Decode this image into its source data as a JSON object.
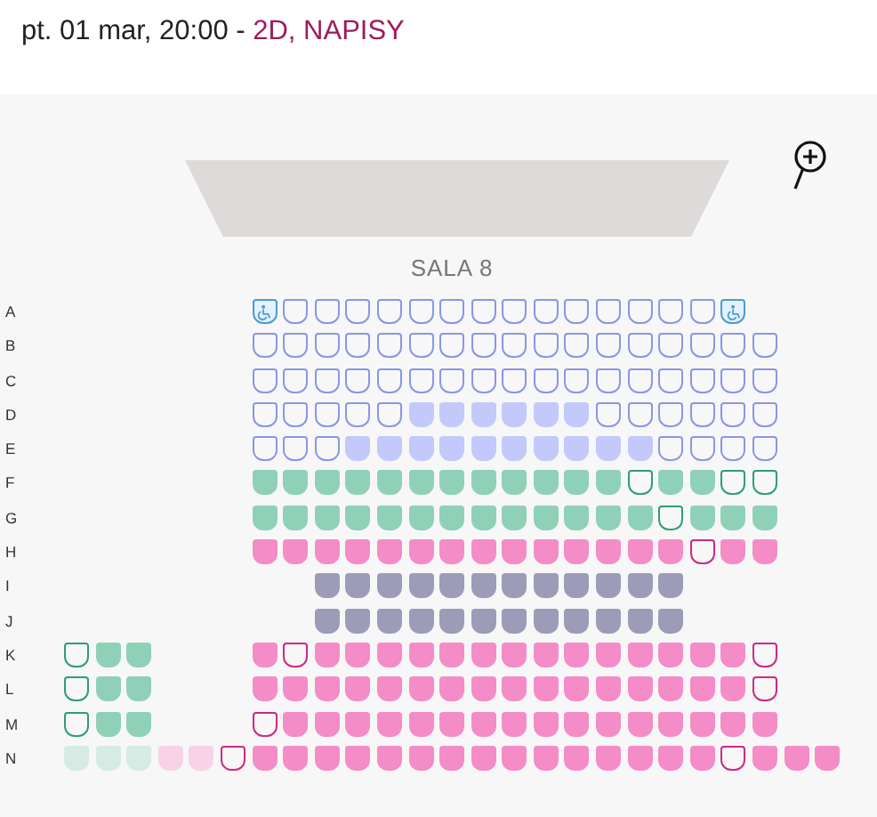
{
  "header": {
    "showtime": "pt. 01 mar, 20:00 - ",
    "format": "2D, NAPISY"
  },
  "hall": {
    "name": "SALA 8"
  },
  "rows": [
    {
      "label": "A",
      "seats": [
        {
          "kind": "aisle"
        },
        {
          "kind": "aisle"
        },
        {
          "kind": "aisle"
        },
        {
          "kind": "aisle"
        },
        {
          "kind": "aisle"
        },
        {
          "kind": "aisle"
        },
        {
          "kind": "wheelchair",
          "color": "#4d9bd0",
          "taken": false
        },
        {
          "kind": "seat",
          "color": "#8a96e6",
          "taken": false
        },
        {
          "kind": "seat",
          "color": "#8a96e6",
          "taken": false
        },
        {
          "kind": "seat",
          "color": "#8a96e6",
          "taken": false
        },
        {
          "kind": "seat",
          "color": "#8a96e6",
          "taken": false
        },
        {
          "kind": "seat",
          "color": "#8a96e6",
          "taken": false
        },
        {
          "kind": "seat",
          "color": "#8a96e6",
          "taken": false
        },
        {
          "kind": "seat",
          "color": "#8a96e6",
          "taken": false
        },
        {
          "kind": "seat",
          "color": "#8a96e6",
          "taken": false
        },
        {
          "kind": "seat",
          "color": "#8a96e6",
          "taken": false
        },
        {
          "kind": "seat",
          "color": "#8a96e6",
          "taken": false
        },
        {
          "kind": "seat",
          "color": "#8a96e6",
          "taken": false
        },
        {
          "kind": "seat",
          "color": "#8a96e6",
          "taken": false
        },
        {
          "kind": "seat",
          "color": "#8a96e6",
          "taken": false
        },
        {
          "kind": "seat",
          "color": "#8a96e6",
          "taken": false
        },
        {
          "kind": "wheelchair",
          "color": "#4d9bd0",
          "taken": false
        }
      ]
    },
    {
      "label": "B",
      "seats": [
        {
          "kind": "aisle"
        },
        {
          "kind": "aisle"
        },
        {
          "kind": "aisle"
        },
        {
          "kind": "aisle"
        },
        {
          "kind": "aisle"
        },
        {
          "kind": "aisle"
        },
        {
          "kind": "seat",
          "color": "#8a96e6",
          "taken": false
        },
        {
          "kind": "seat",
          "color": "#8a96e6",
          "taken": false
        },
        {
          "kind": "seat",
          "color": "#8a96e6",
          "taken": false
        },
        {
          "kind": "seat",
          "color": "#8a96e6",
          "taken": false
        },
        {
          "kind": "seat",
          "color": "#8a96e6",
          "taken": false
        },
        {
          "kind": "seat",
          "color": "#8a96e6",
          "taken": false
        },
        {
          "kind": "seat",
          "color": "#8a96e6",
          "taken": false
        },
        {
          "kind": "seat",
          "color": "#8a96e6",
          "taken": false
        },
        {
          "kind": "seat",
          "color": "#8a96e6",
          "taken": false
        },
        {
          "kind": "seat",
          "color": "#8a96e6",
          "taken": false
        },
        {
          "kind": "seat",
          "color": "#8a96e6",
          "taken": false
        },
        {
          "kind": "seat",
          "color": "#8a96e6",
          "taken": false
        },
        {
          "kind": "seat",
          "color": "#8a96e6",
          "taken": false
        },
        {
          "kind": "seat",
          "color": "#8a96e6",
          "taken": false
        },
        {
          "kind": "seat",
          "color": "#8a96e6",
          "taken": false
        },
        {
          "kind": "seat",
          "color": "#8a96e6",
          "taken": false
        },
        {
          "kind": "seat",
          "color": "#8a96e6",
          "taken": false
        }
      ]
    },
    {
      "label": "C",
      "seats": [
        {
          "kind": "aisle"
        },
        {
          "kind": "aisle"
        },
        {
          "kind": "aisle"
        },
        {
          "kind": "aisle"
        },
        {
          "kind": "aisle"
        },
        {
          "kind": "aisle"
        },
        {
          "kind": "seat",
          "color": "#8a96e6",
          "taken": false
        },
        {
          "kind": "seat",
          "color": "#8a96e6",
          "taken": false
        },
        {
          "kind": "seat",
          "color": "#8a96e6",
          "taken": false
        },
        {
          "kind": "seat",
          "color": "#8a96e6",
          "taken": false
        },
        {
          "kind": "seat",
          "color": "#8a96e6",
          "taken": false
        },
        {
          "kind": "seat",
          "color": "#8a96e6",
          "taken": false
        },
        {
          "kind": "seat",
          "color": "#8a96e6",
          "taken": false
        },
        {
          "kind": "seat",
          "color": "#8a96e6",
          "taken": false
        },
        {
          "kind": "seat",
          "color": "#8a96e6",
          "taken": false
        },
        {
          "kind": "seat",
          "color": "#8a96e6",
          "taken": false
        },
        {
          "kind": "seat",
          "color": "#8a96e6",
          "taken": false
        },
        {
          "kind": "seat",
          "color": "#8a96e6",
          "taken": false
        },
        {
          "kind": "seat",
          "color": "#8a96e6",
          "taken": false
        },
        {
          "kind": "seat",
          "color": "#8a96e6",
          "taken": false
        },
        {
          "kind": "seat",
          "color": "#8a96e6",
          "taken": false
        },
        {
          "kind": "seat",
          "color": "#8a96e6",
          "taken": false
        },
        {
          "kind": "seat",
          "color": "#8a96e6",
          "taken": false
        }
      ]
    },
    {
      "label": "D",
      "seats": [
        {
          "kind": "aisle"
        },
        {
          "kind": "aisle"
        },
        {
          "kind": "aisle"
        },
        {
          "kind": "aisle"
        },
        {
          "kind": "aisle"
        },
        {
          "kind": "aisle"
        },
        {
          "kind": "seat",
          "color": "#8a96e6",
          "taken": false
        },
        {
          "kind": "seat",
          "color": "#8a96e6",
          "taken": false
        },
        {
          "kind": "seat",
          "color": "#8a96e6",
          "taken": false
        },
        {
          "kind": "seat",
          "color": "#8a96e6",
          "taken": false
        },
        {
          "kind": "seat",
          "color": "#8a96e6",
          "taken": false
        },
        {
          "kind": "seat",
          "color": "#c3c9fa",
          "taken": true
        },
        {
          "kind": "seat",
          "color": "#c3c9fa",
          "taken": true
        },
        {
          "kind": "seat",
          "color": "#c3c9fa",
          "taken": true
        },
        {
          "kind": "seat",
          "color": "#c3c9fa",
          "taken": true
        },
        {
          "kind": "seat",
          "color": "#c3c9fa",
          "taken": true
        },
        {
          "kind": "seat",
          "color": "#c3c9fa",
          "taken": true
        },
        {
          "kind": "seat",
          "color": "#8a96e6",
          "taken": false
        },
        {
          "kind": "seat",
          "color": "#8a96e6",
          "taken": false
        },
        {
          "kind": "seat",
          "color": "#8a96e6",
          "taken": false
        },
        {
          "kind": "seat",
          "color": "#8a96e6",
          "taken": false
        },
        {
          "kind": "seat",
          "color": "#8a96e6",
          "taken": false
        },
        {
          "kind": "seat",
          "color": "#8a96e6",
          "taken": false
        }
      ]
    },
    {
      "label": "E",
      "seats": [
        {
          "kind": "aisle"
        },
        {
          "kind": "aisle"
        },
        {
          "kind": "aisle"
        },
        {
          "kind": "aisle"
        },
        {
          "kind": "aisle"
        },
        {
          "kind": "aisle"
        },
        {
          "kind": "seat",
          "color": "#8a96e6",
          "taken": false
        },
        {
          "kind": "seat",
          "color": "#8a96e6",
          "taken": false
        },
        {
          "kind": "seat",
          "color": "#8a96e6",
          "taken": false
        },
        {
          "kind": "seat",
          "color": "#c3c9fa",
          "taken": true
        },
        {
          "kind": "seat",
          "color": "#c3c9fa",
          "taken": true
        },
        {
          "kind": "seat",
          "color": "#c3c9fa",
          "taken": true
        },
        {
          "kind": "seat",
          "color": "#c3c9fa",
          "taken": true
        },
        {
          "kind": "seat",
          "color": "#c3c9fa",
          "taken": true
        },
        {
          "kind": "seat",
          "color": "#c3c9fa",
          "taken": true
        },
        {
          "kind": "seat",
          "color": "#c3c9fa",
          "taken": true
        },
        {
          "kind": "seat",
          "color": "#c3c9fa",
          "taken": true
        },
        {
          "kind": "seat",
          "color": "#c3c9fa",
          "taken": true
        },
        {
          "kind": "seat",
          "color": "#c3c9fa",
          "taken": true
        },
        {
          "kind": "seat",
          "color": "#8a96e6",
          "taken": false
        },
        {
          "kind": "seat",
          "color": "#8a96e6",
          "taken": false
        },
        {
          "kind": "seat",
          "color": "#8a96e6",
          "taken": false
        },
        {
          "kind": "seat",
          "color": "#8a96e6",
          "taken": false
        }
      ]
    },
    {
      "label": "F",
      "seats": [
        {
          "kind": "aisle"
        },
        {
          "kind": "aisle"
        },
        {
          "kind": "aisle"
        },
        {
          "kind": "aisle"
        },
        {
          "kind": "aisle"
        },
        {
          "kind": "aisle"
        },
        {
          "kind": "seat",
          "color": "#8fd1b8",
          "taken": true
        },
        {
          "kind": "seat",
          "color": "#8fd1b8",
          "taken": true
        },
        {
          "kind": "seat",
          "color": "#8fd1b8",
          "taken": true
        },
        {
          "kind": "seat",
          "color": "#8fd1b8",
          "taken": true
        },
        {
          "kind": "seat",
          "color": "#8fd1b8",
          "taken": true
        },
        {
          "kind": "seat",
          "color": "#8fd1b8",
          "taken": true
        },
        {
          "kind": "seat",
          "color": "#8fd1b8",
          "taken": true
        },
        {
          "kind": "seat",
          "color": "#8fd1b8",
          "taken": true
        },
        {
          "kind": "seat",
          "color": "#8fd1b8",
          "taken": true
        },
        {
          "kind": "seat",
          "color": "#8fd1b8",
          "taken": true
        },
        {
          "kind": "seat",
          "color": "#8fd1b8",
          "taken": true
        },
        {
          "kind": "seat",
          "color": "#8fd1b8",
          "taken": true
        },
        {
          "kind": "seat",
          "color": "#2e9d78",
          "taken": false
        },
        {
          "kind": "seat",
          "color": "#8fd1b8",
          "taken": true
        },
        {
          "kind": "seat",
          "color": "#8fd1b8",
          "taken": true
        },
        {
          "kind": "seat",
          "color": "#2e9d78",
          "taken": false
        },
        {
          "kind": "seat",
          "color": "#2e9d78",
          "taken": false
        }
      ]
    },
    {
      "label": "G",
      "seats": [
        {
          "kind": "aisle"
        },
        {
          "kind": "aisle"
        },
        {
          "kind": "aisle"
        },
        {
          "kind": "aisle"
        },
        {
          "kind": "aisle"
        },
        {
          "kind": "aisle"
        },
        {
          "kind": "seat",
          "color": "#8fd1b8",
          "taken": true
        },
        {
          "kind": "seat",
          "color": "#8fd1b8",
          "taken": true
        },
        {
          "kind": "seat",
          "color": "#8fd1b8",
          "taken": true
        },
        {
          "kind": "seat",
          "color": "#8fd1b8",
          "taken": true
        },
        {
          "kind": "seat",
          "color": "#8fd1b8",
          "taken": true
        },
        {
          "kind": "seat",
          "color": "#8fd1b8",
          "taken": true
        },
        {
          "kind": "seat",
          "color": "#8fd1b8",
          "taken": true
        },
        {
          "kind": "seat",
          "color": "#8fd1b8",
          "taken": true
        },
        {
          "kind": "seat",
          "color": "#8fd1b8",
          "taken": true
        },
        {
          "kind": "seat",
          "color": "#8fd1b8",
          "taken": true
        },
        {
          "kind": "seat",
          "color": "#8fd1b8",
          "taken": true
        },
        {
          "kind": "seat",
          "color": "#8fd1b8",
          "taken": true
        },
        {
          "kind": "seat",
          "color": "#8fd1b8",
          "taken": true
        },
        {
          "kind": "seat",
          "color": "#2e9d78",
          "taken": false
        },
        {
          "kind": "seat",
          "color": "#8fd1b8",
          "taken": true
        },
        {
          "kind": "seat",
          "color": "#8fd1b8",
          "taken": true
        },
        {
          "kind": "seat",
          "color": "#8fd1b8",
          "taken": true
        }
      ]
    },
    {
      "label": "H",
      "seats": [
        {
          "kind": "aisle"
        },
        {
          "kind": "aisle"
        },
        {
          "kind": "aisle"
        },
        {
          "kind": "aisle"
        },
        {
          "kind": "aisle"
        },
        {
          "kind": "aisle"
        },
        {
          "kind": "seat",
          "color": "#f48cc8",
          "taken": true
        },
        {
          "kind": "seat",
          "color": "#f48cc8",
          "taken": true
        },
        {
          "kind": "seat",
          "color": "#f48cc8",
          "taken": true
        },
        {
          "kind": "seat",
          "color": "#f48cc8",
          "taken": true
        },
        {
          "kind": "seat",
          "color": "#f48cc8",
          "taken": true
        },
        {
          "kind": "seat",
          "color": "#f48cc8",
          "taken": true
        },
        {
          "kind": "seat",
          "color": "#f48cc8",
          "taken": true
        },
        {
          "kind": "seat",
          "color": "#f48cc8",
          "taken": true
        },
        {
          "kind": "seat",
          "color": "#f48cc8",
          "taken": true
        },
        {
          "kind": "seat",
          "color": "#f48cc8",
          "taken": true
        },
        {
          "kind": "seat",
          "color": "#f48cc8",
          "taken": true
        },
        {
          "kind": "seat",
          "color": "#f48cc8",
          "taken": true
        },
        {
          "kind": "seat",
          "color": "#f48cc8",
          "taken": true
        },
        {
          "kind": "seat",
          "color": "#f48cc8",
          "taken": true
        },
        {
          "kind": "seat",
          "color": "#cc2a85",
          "taken": false
        },
        {
          "kind": "seat",
          "color": "#f48cc8",
          "taken": true
        },
        {
          "kind": "seat",
          "color": "#f48cc8",
          "taken": true
        }
      ]
    },
    {
      "label": "I",
      "seats": [
        {
          "kind": "aisle"
        },
        {
          "kind": "aisle"
        },
        {
          "kind": "aisle"
        },
        {
          "kind": "aisle"
        },
        {
          "kind": "aisle"
        },
        {
          "kind": "aisle"
        },
        {
          "kind": "aisle"
        },
        {
          "kind": "aisle"
        },
        {
          "kind": "seat",
          "color": "#9c9cb8",
          "taken": true
        },
        {
          "kind": "seat",
          "color": "#9c9cb8",
          "taken": true
        },
        {
          "kind": "seat",
          "color": "#9c9cb8",
          "taken": true
        },
        {
          "kind": "seat",
          "color": "#9c9cb8",
          "taken": true
        },
        {
          "kind": "seat",
          "color": "#9c9cb8",
          "taken": true
        },
        {
          "kind": "seat",
          "color": "#9c9cb8",
          "taken": true
        },
        {
          "kind": "seat",
          "color": "#9c9cb8",
          "taken": true
        },
        {
          "kind": "seat",
          "color": "#9c9cb8",
          "taken": true
        },
        {
          "kind": "seat",
          "color": "#9c9cb8",
          "taken": true
        },
        {
          "kind": "seat",
          "color": "#9c9cb8",
          "taken": true
        },
        {
          "kind": "seat",
          "color": "#9c9cb8",
          "taken": true
        },
        {
          "kind": "seat",
          "color": "#9c9cb8",
          "taken": true
        }
      ]
    },
    {
      "label": "J",
      "seats": [
        {
          "kind": "aisle"
        },
        {
          "kind": "aisle"
        },
        {
          "kind": "aisle"
        },
        {
          "kind": "aisle"
        },
        {
          "kind": "aisle"
        },
        {
          "kind": "aisle"
        },
        {
          "kind": "aisle"
        },
        {
          "kind": "aisle"
        },
        {
          "kind": "seat",
          "color": "#9c9cb8",
          "taken": true
        },
        {
          "kind": "seat",
          "color": "#9c9cb8",
          "taken": true
        },
        {
          "kind": "seat",
          "color": "#9c9cb8",
          "taken": true
        },
        {
          "kind": "seat",
          "color": "#9c9cb8",
          "taken": true
        },
        {
          "kind": "seat",
          "color": "#9c9cb8",
          "taken": true
        },
        {
          "kind": "seat",
          "color": "#9c9cb8",
          "taken": true
        },
        {
          "kind": "seat",
          "color": "#9c9cb8",
          "taken": true
        },
        {
          "kind": "seat",
          "color": "#9c9cb8",
          "taken": true
        },
        {
          "kind": "seat",
          "color": "#9c9cb8",
          "taken": true
        },
        {
          "kind": "seat",
          "color": "#9c9cb8",
          "taken": true
        },
        {
          "kind": "seat",
          "color": "#9c9cb8",
          "taken": true
        },
        {
          "kind": "seat",
          "color": "#9c9cb8",
          "taken": true
        }
      ]
    },
    {
      "label": "K",
      "seats": [
        {
          "kind": "seat",
          "color": "#2e9d78",
          "taken": false
        },
        {
          "kind": "seat",
          "color": "#8fd1b8",
          "taken": true
        },
        {
          "kind": "seat",
          "color": "#8fd1b8",
          "taken": true
        },
        {
          "kind": "aisle"
        },
        {
          "kind": "aisle"
        },
        {
          "kind": "aisle"
        },
        {
          "kind": "seat",
          "color": "#f48cc8",
          "taken": true
        },
        {
          "kind": "seat",
          "color": "#cc2a85",
          "taken": false
        },
        {
          "kind": "seat",
          "color": "#f48cc8",
          "taken": true
        },
        {
          "kind": "seat",
          "color": "#f48cc8",
          "taken": true
        },
        {
          "kind": "seat",
          "color": "#f48cc8",
          "taken": true
        },
        {
          "kind": "seat",
          "color": "#f48cc8",
          "taken": true
        },
        {
          "kind": "seat",
          "color": "#f48cc8",
          "taken": true
        },
        {
          "kind": "seat",
          "color": "#f48cc8",
          "taken": true
        },
        {
          "kind": "seat",
          "color": "#f48cc8",
          "taken": true
        },
        {
          "kind": "seat",
          "color": "#f48cc8",
          "taken": true
        },
        {
          "kind": "seat",
          "color": "#f48cc8",
          "taken": true
        },
        {
          "kind": "seat",
          "color": "#f48cc8",
          "taken": true
        },
        {
          "kind": "seat",
          "color": "#f48cc8",
          "taken": true
        },
        {
          "kind": "seat",
          "color": "#f48cc8",
          "taken": true
        },
        {
          "kind": "seat",
          "color": "#f48cc8",
          "taken": true
        },
        {
          "kind": "seat",
          "color": "#f48cc8",
          "taken": true
        },
        {
          "kind": "seat",
          "color": "#cc2a85",
          "taken": false
        }
      ]
    },
    {
      "label": "L",
      "seats": [
        {
          "kind": "seat",
          "color": "#2e9d78",
          "taken": false
        },
        {
          "kind": "seat",
          "color": "#8fd1b8",
          "taken": true
        },
        {
          "kind": "seat",
          "color": "#8fd1b8",
          "taken": true
        },
        {
          "kind": "aisle"
        },
        {
          "kind": "aisle"
        },
        {
          "kind": "aisle"
        },
        {
          "kind": "seat",
          "color": "#f48cc8",
          "taken": true
        },
        {
          "kind": "seat",
          "color": "#f48cc8",
          "taken": true
        },
        {
          "kind": "seat",
          "color": "#f48cc8",
          "taken": true
        },
        {
          "kind": "seat",
          "color": "#f48cc8",
          "taken": true
        },
        {
          "kind": "seat",
          "color": "#f48cc8",
          "taken": true
        },
        {
          "kind": "seat",
          "color": "#f48cc8",
          "taken": true
        },
        {
          "kind": "seat",
          "color": "#f48cc8",
          "taken": true
        },
        {
          "kind": "seat",
          "color": "#f48cc8",
          "taken": true
        },
        {
          "kind": "seat",
          "color": "#f48cc8",
          "taken": true
        },
        {
          "kind": "seat",
          "color": "#f48cc8",
          "taken": true
        },
        {
          "kind": "seat",
          "color": "#f48cc8",
          "taken": true
        },
        {
          "kind": "seat",
          "color": "#f48cc8",
          "taken": true
        },
        {
          "kind": "seat",
          "color": "#f48cc8",
          "taken": true
        },
        {
          "kind": "seat",
          "color": "#f48cc8",
          "taken": true
        },
        {
          "kind": "seat",
          "color": "#f48cc8",
          "taken": true
        },
        {
          "kind": "seat",
          "color": "#f48cc8",
          "taken": true
        },
        {
          "kind": "seat",
          "color": "#cc2a85",
          "taken": false
        }
      ]
    },
    {
      "label": "M",
      "seats": [
        {
          "kind": "seat",
          "color": "#2e9d78",
          "taken": false
        },
        {
          "kind": "seat",
          "color": "#8fd1b8",
          "taken": true
        },
        {
          "kind": "seat",
          "color": "#8fd1b8",
          "taken": true
        },
        {
          "kind": "aisle"
        },
        {
          "kind": "aisle"
        },
        {
          "kind": "aisle"
        },
        {
          "kind": "seat",
          "color": "#cc2a85",
          "taken": false
        },
        {
          "kind": "seat",
          "color": "#f48cc8",
          "taken": true
        },
        {
          "kind": "seat",
          "color": "#f48cc8",
          "taken": true
        },
        {
          "kind": "seat",
          "color": "#f48cc8",
          "taken": true
        },
        {
          "kind": "seat",
          "color": "#f48cc8",
          "taken": true
        },
        {
          "kind": "seat",
          "color": "#f48cc8",
          "taken": true
        },
        {
          "kind": "seat",
          "color": "#f48cc8",
          "taken": true
        },
        {
          "kind": "seat",
          "color": "#f48cc8",
          "taken": true
        },
        {
          "kind": "seat",
          "color": "#f48cc8",
          "taken": true
        },
        {
          "kind": "seat",
          "color": "#f48cc8",
          "taken": true
        },
        {
          "kind": "seat",
          "color": "#f48cc8",
          "taken": true
        },
        {
          "kind": "seat",
          "color": "#f48cc8",
          "taken": true
        },
        {
          "kind": "seat",
          "color": "#f48cc8",
          "taken": true
        },
        {
          "kind": "seat",
          "color": "#f48cc8",
          "taken": true
        },
        {
          "kind": "seat",
          "color": "#f48cc8",
          "taken": true
        },
        {
          "kind": "seat",
          "color": "#f48cc8",
          "taken": true
        },
        {
          "kind": "seat",
          "color": "#f48cc8",
          "taken": true
        }
      ]
    },
    {
      "label": "N",
      "seats": [
        {
          "kind": "blocked",
          "color": "#d6ebe4"
        },
        {
          "kind": "blocked",
          "color": "#d6ebe4"
        },
        {
          "kind": "blocked",
          "color": "#d6ebe4"
        },
        {
          "kind": "blocked",
          "color": "#f8d3e8"
        },
        {
          "kind": "blocked",
          "color": "#f8d3e8"
        },
        {
          "kind": "seat",
          "color": "#cc2a85",
          "taken": false
        },
        {
          "kind": "seat",
          "color": "#f48cc8",
          "taken": true
        },
        {
          "kind": "seat",
          "color": "#f48cc8",
          "taken": true
        },
        {
          "kind": "seat",
          "color": "#f48cc8",
          "taken": true
        },
        {
          "kind": "seat",
          "color": "#f48cc8",
          "taken": true
        },
        {
          "kind": "seat",
          "color": "#f48cc8",
          "taken": true
        },
        {
          "kind": "seat",
          "color": "#f48cc8",
          "taken": true
        },
        {
          "kind": "seat",
          "color": "#f48cc8",
          "taken": true
        },
        {
          "kind": "seat",
          "color": "#f48cc8",
          "taken": true
        },
        {
          "kind": "seat",
          "color": "#f48cc8",
          "taken": true
        },
        {
          "kind": "seat",
          "color": "#f48cc8",
          "taken": true
        },
        {
          "kind": "seat",
          "color": "#f48cc8",
          "taken": true
        },
        {
          "kind": "seat",
          "color": "#f48cc8",
          "taken": true
        },
        {
          "kind": "seat",
          "color": "#f48cc8",
          "taken": true
        },
        {
          "kind": "seat",
          "color": "#f48cc8",
          "taken": true
        },
        {
          "kind": "seat",
          "color": "#f48cc8",
          "taken": true
        },
        {
          "kind": "seat",
          "color": "#cc2a85",
          "taken": false
        },
        {
          "kind": "seat",
          "color": "#f48cc8",
          "taken": true
        },
        {
          "kind": "seat",
          "color": "#f48cc8",
          "taken": true
        },
        {
          "kind": "seat",
          "color": "#f48cc8",
          "taken": true
        }
      ]
    }
  ]
}
